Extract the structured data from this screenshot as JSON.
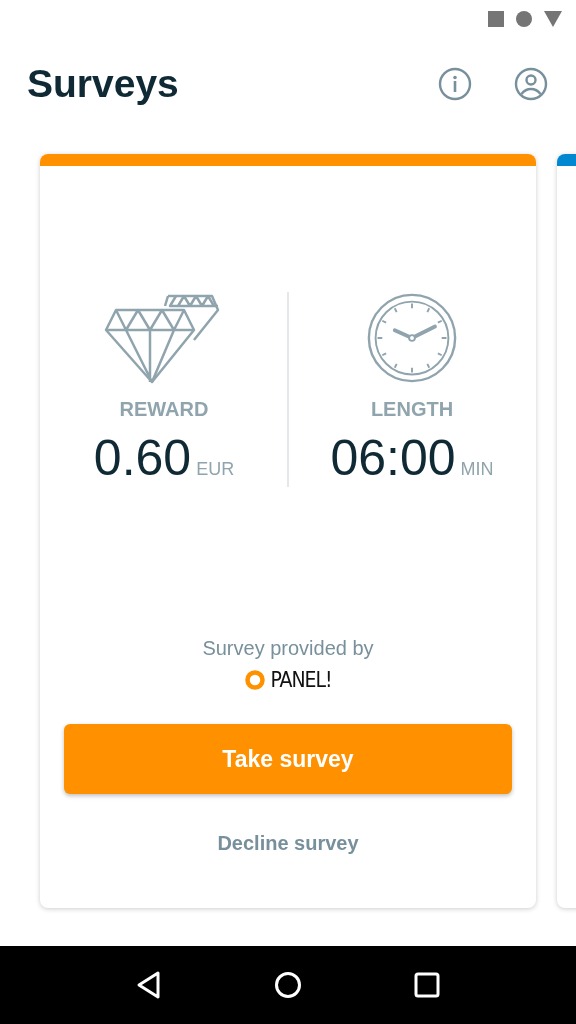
{
  "app_bar": {
    "title": "Surveys"
  },
  "cards": [
    {
      "color": "#ff9100",
      "stats": [
        {
          "kind": "reward",
          "label": "REWARD",
          "value": "0.60",
          "unit": "EUR"
        },
        {
          "kind": "length",
          "label": "LENGTH",
          "value": "06:00",
          "unit": "MIN"
        }
      ],
      "provider_text": "Survey provided by",
      "provider_name": "PANEL!",
      "primary_button": "Take survey",
      "secondary_button": "Decline survey"
    },
    {
      "color": "#0288d1"
    }
  ]
}
